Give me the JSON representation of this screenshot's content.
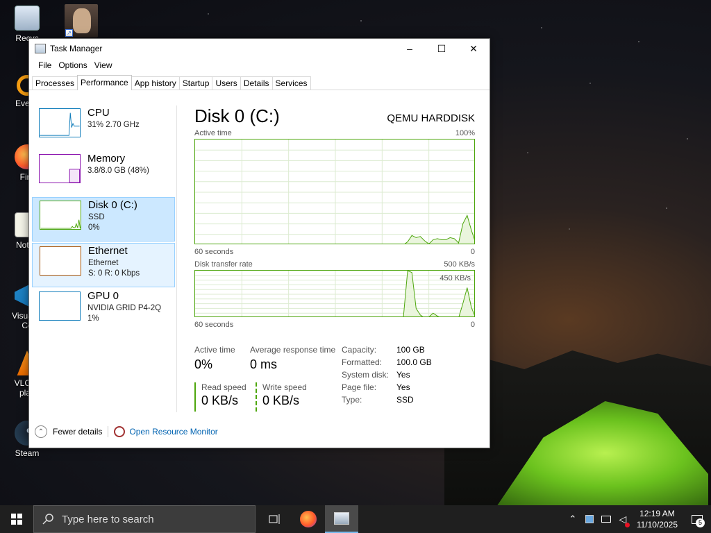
{
  "desktop": {
    "icons": [
      {
        "label": "Recyc",
        "icon": "recycle-bin-icon"
      },
      {
        "label": "Everyt",
        "icon": "everything-search-icon"
      },
      {
        "label": "Fire",
        "icon": "firefox-icon"
      },
      {
        "label": "Notep",
        "icon": "notepad-icon"
      },
      {
        "label": "Visual S",
        "label2": "Co",
        "icon": "vscode-icon"
      },
      {
        "label": "VLC m",
        "label2": "play",
        "icon": "vlc-icon"
      },
      {
        "label": "Steam",
        "icon": "steam-icon"
      }
    ]
  },
  "window": {
    "title": "Task Manager",
    "controls": {
      "minimize": "–",
      "maximize": "☐",
      "close": "✕"
    },
    "menu": [
      "File",
      "Options",
      "View"
    ],
    "tabs": [
      "Processes",
      "Performance",
      "App history",
      "Startup",
      "Users",
      "Details",
      "Services"
    ],
    "active_tab": "Performance",
    "sidebar": [
      {
        "name": "CPU",
        "sub1": "31% 2.70 GHz",
        "sub2": "",
        "color": "#117dbb"
      },
      {
        "name": "Memory",
        "sub1": "3.8/8.0 GB (48%)",
        "sub2": "",
        "color": "#8b12ae"
      },
      {
        "name": "Disk 0 (C:)",
        "sub1": "SSD",
        "sub2": "0%",
        "color": "#4da60c"
      },
      {
        "name": "Ethernet",
        "sub1": "Ethernet",
        "sub2": "S: 0 R: 0 Kbps",
        "color": "#a74f01"
      },
      {
        "name": "GPU 0",
        "sub1": "NVIDIA GRID P4-2Q",
        "sub2": "1%",
        "color": "#117dbb"
      }
    ],
    "detail": {
      "title": "Disk 0 (C:)",
      "model": "QEMU HARDDISK",
      "graph1": {
        "label": "Active time",
        "max": "100%",
        "time": "60 seconds",
        "min": "0",
        "values": [
          0,
          0,
          0,
          0,
          0,
          0,
          0,
          0,
          0,
          0,
          0,
          0,
          0,
          0,
          0,
          0,
          0,
          0,
          0,
          0,
          0,
          0,
          0,
          0,
          0,
          0,
          0,
          0,
          0,
          0,
          0,
          0,
          0,
          0,
          0,
          0,
          0,
          0,
          0,
          0,
          0,
          0,
          0,
          0,
          0,
          0,
          0,
          0,
          0,
          0,
          3,
          9,
          7,
          8,
          4,
          1,
          5,
          6,
          5,
          5,
          7,
          6,
          2,
          20,
          28,
          14,
          2
        ]
      },
      "graph2": {
        "label": "Disk transfer rate",
        "max": "500 KB/s",
        "inner": "450 KB/s",
        "time": "60 seconds",
        "min": "0",
        "values": [
          0,
          0,
          0,
          0,
          0,
          0,
          0,
          0,
          0,
          0,
          0,
          0,
          0,
          0,
          0,
          0,
          0,
          0,
          0,
          0,
          0,
          0,
          0,
          0,
          0,
          0,
          0,
          0,
          0,
          0,
          0,
          0,
          0,
          0,
          0,
          0,
          0,
          0,
          0,
          0,
          0,
          0,
          0,
          0,
          0,
          0,
          0,
          0,
          0,
          0,
          510,
          480,
          100,
          30,
          0,
          10,
          50,
          20,
          0,
          0,
          10,
          0,
          0,
          150,
          320,
          110,
          0
        ]
      },
      "stats": {
        "active_time_label": "Active time",
        "active_time": "0%",
        "resp_label": "Average response time",
        "resp": "0 ms",
        "read_label": "Read speed",
        "read": "0 KB/s",
        "write_label": "Write speed",
        "write": "0 KB/s"
      },
      "props": [
        {
          "k": "Capacity:",
          "v": "100 GB"
        },
        {
          "k": "Formatted:",
          "v": "100.0 GB"
        },
        {
          "k": "System disk:",
          "v": "Yes"
        },
        {
          "k": "Page file:",
          "v": "Yes"
        },
        {
          "k": "Type:",
          "v": "SSD"
        }
      ]
    },
    "footer": {
      "fewer": "Fewer details",
      "monitor": "Open Resource Monitor"
    }
  },
  "taskbar": {
    "search_placeholder": "Type here to search",
    "time": "12:19 AM",
    "date": "11/10/2025",
    "notifications": "5"
  }
}
